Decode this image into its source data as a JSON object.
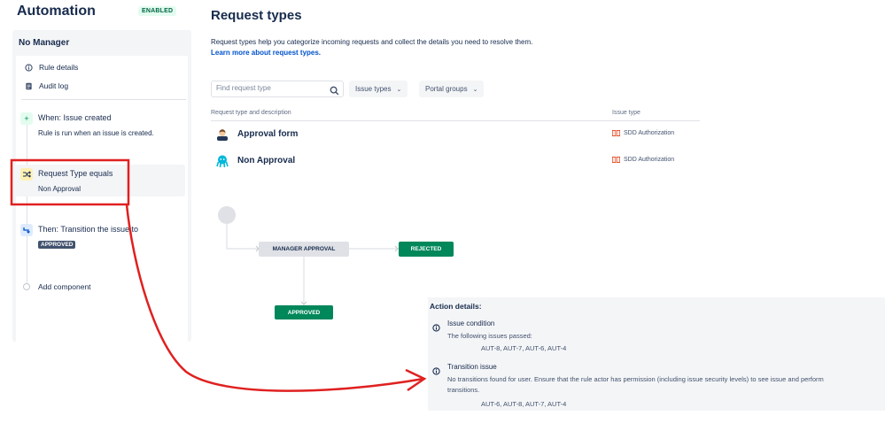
{
  "app": {
    "title": "Automation",
    "status_badge": "ENABLED"
  },
  "rule": {
    "name": "No Manager",
    "nav": [
      {
        "label": "Rule details",
        "icon": "info-icon"
      },
      {
        "label": "Audit log",
        "icon": "document-icon"
      }
    ],
    "trigger": {
      "title": "When: Issue created",
      "subtitle": "Rule is run when an issue is created.",
      "icon": "plus-icon"
    },
    "condition": {
      "title": "Request Type equals",
      "subtitle": "Non Approval",
      "icon": "shuffle-icon"
    },
    "action": {
      "title": "Then: Transition the issue to",
      "status": "APPROVED",
      "icon": "transition-icon"
    },
    "add_component": "Add component"
  },
  "main": {
    "title": "Request types",
    "description": "Request types help you categorize incoming requests and collect the details you need to resolve them.",
    "learn_more": "Learn more about request types.",
    "search": {
      "placeholder": "Find request type"
    },
    "filters": {
      "issue_types": "Issue types",
      "portal_groups": "Portal groups"
    },
    "columns": {
      "request_type": "Request type and description",
      "issue_type": "Issue type"
    },
    "rows": [
      {
        "name": "Approval form",
        "issue_type": "SDD Authorization",
        "icon": "person-icon"
      },
      {
        "name": "Non Approval",
        "issue_type": "SDD Authorization",
        "icon": "octopus-icon"
      }
    ]
  },
  "workflow": {
    "nodes": {
      "manager_approval": "MANAGER APPROVAL",
      "rejected": "REJECTED",
      "approved": "APPROVED"
    }
  },
  "action_details": {
    "title": "Action details:",
    "items": [
      {
        "heading": "Issue condition",
        "text": "The following issues passed:",
        "keys": "AUT-8, AUT-7, AUT-6, AUT-4"
      },
      {
        "heading": "Transition issue",
        "text_line1": "No transitions found for user. Ensure that the rule actor has permission (including issue security levels) to see issue and perform",
        "text_line2": "transitions.",
        "keys": "AUT-6, AUT-8, AUT-7, AUT-4"
      }
    ]
  },
  "colors": {
    "brand_blue": "#0052cc",
    "success_green": "#00875a",
    "annotation_red": "#e02020"
  }
}
